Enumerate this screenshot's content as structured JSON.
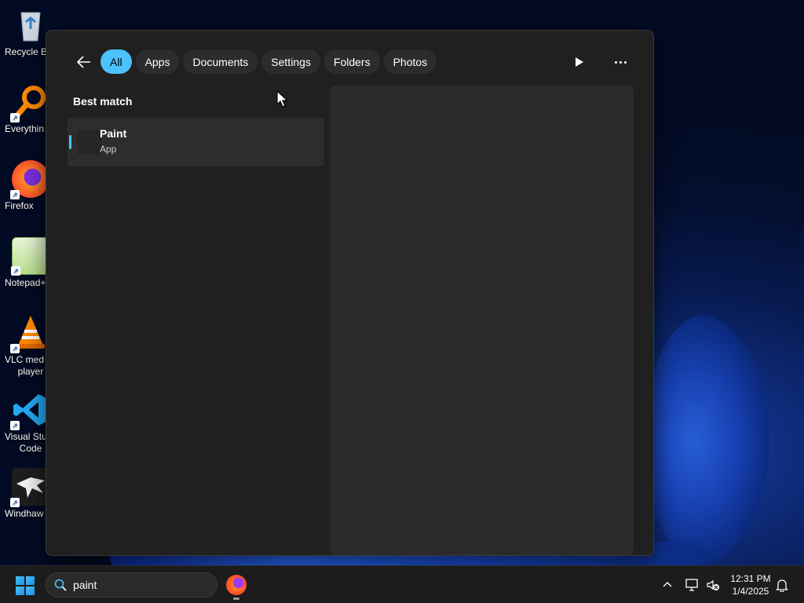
{
  "desktop": {
    "icons": [
      {
        "label": "Recycle B",
        "icon": "recycle-bin-icon"
      },
      {
        "label": "Everythin",
        "icon": "everything-search-icon"
      },
      {
        "label": "Firefox",
        "icon": "firefox-icon"
      },
      {
        "label": "Notepad+",
        "icon": "notepad-plus-plus-icon"
      },
      {
        "label": "VLC med\nplayer",
        "line1": "VLC med",
        "line2": "player",
        "icon": "vlc-icon"
      },
      {
        "label": "Visual Stu\nCode",
        "line1": "Visual Stu",
        "line2": "Code",
        "icon": "vscode-icon"
      },
      {
        "label": "Windhaw",
        "icon": "windhawk-icon"
      }
    ]
  },
  "search": {
    "filters": [
      {
        "label": "All",
        "active": true
      },
      {
        "label": "Apps",
        "active": false
      },
      {
        "label": "Documents",
        "active": false
      },
      {
        "label": "Settings",
        "active": false
      },
      {
        "label": "Folders",
        "active": false
      },
      {
        "label": "Photos",
        "active": false
      }
    ],
    "best_match_title": "Best match",
    "best_match": {
      "name": "Paint",
      "type": "App"
    },
    "query": "paint",
    "accent_color": "#4cc2ff"
  },
  "taskbar": {
    "time": "12:31 PM",
    "date": "1/4/2025"
  }
}
